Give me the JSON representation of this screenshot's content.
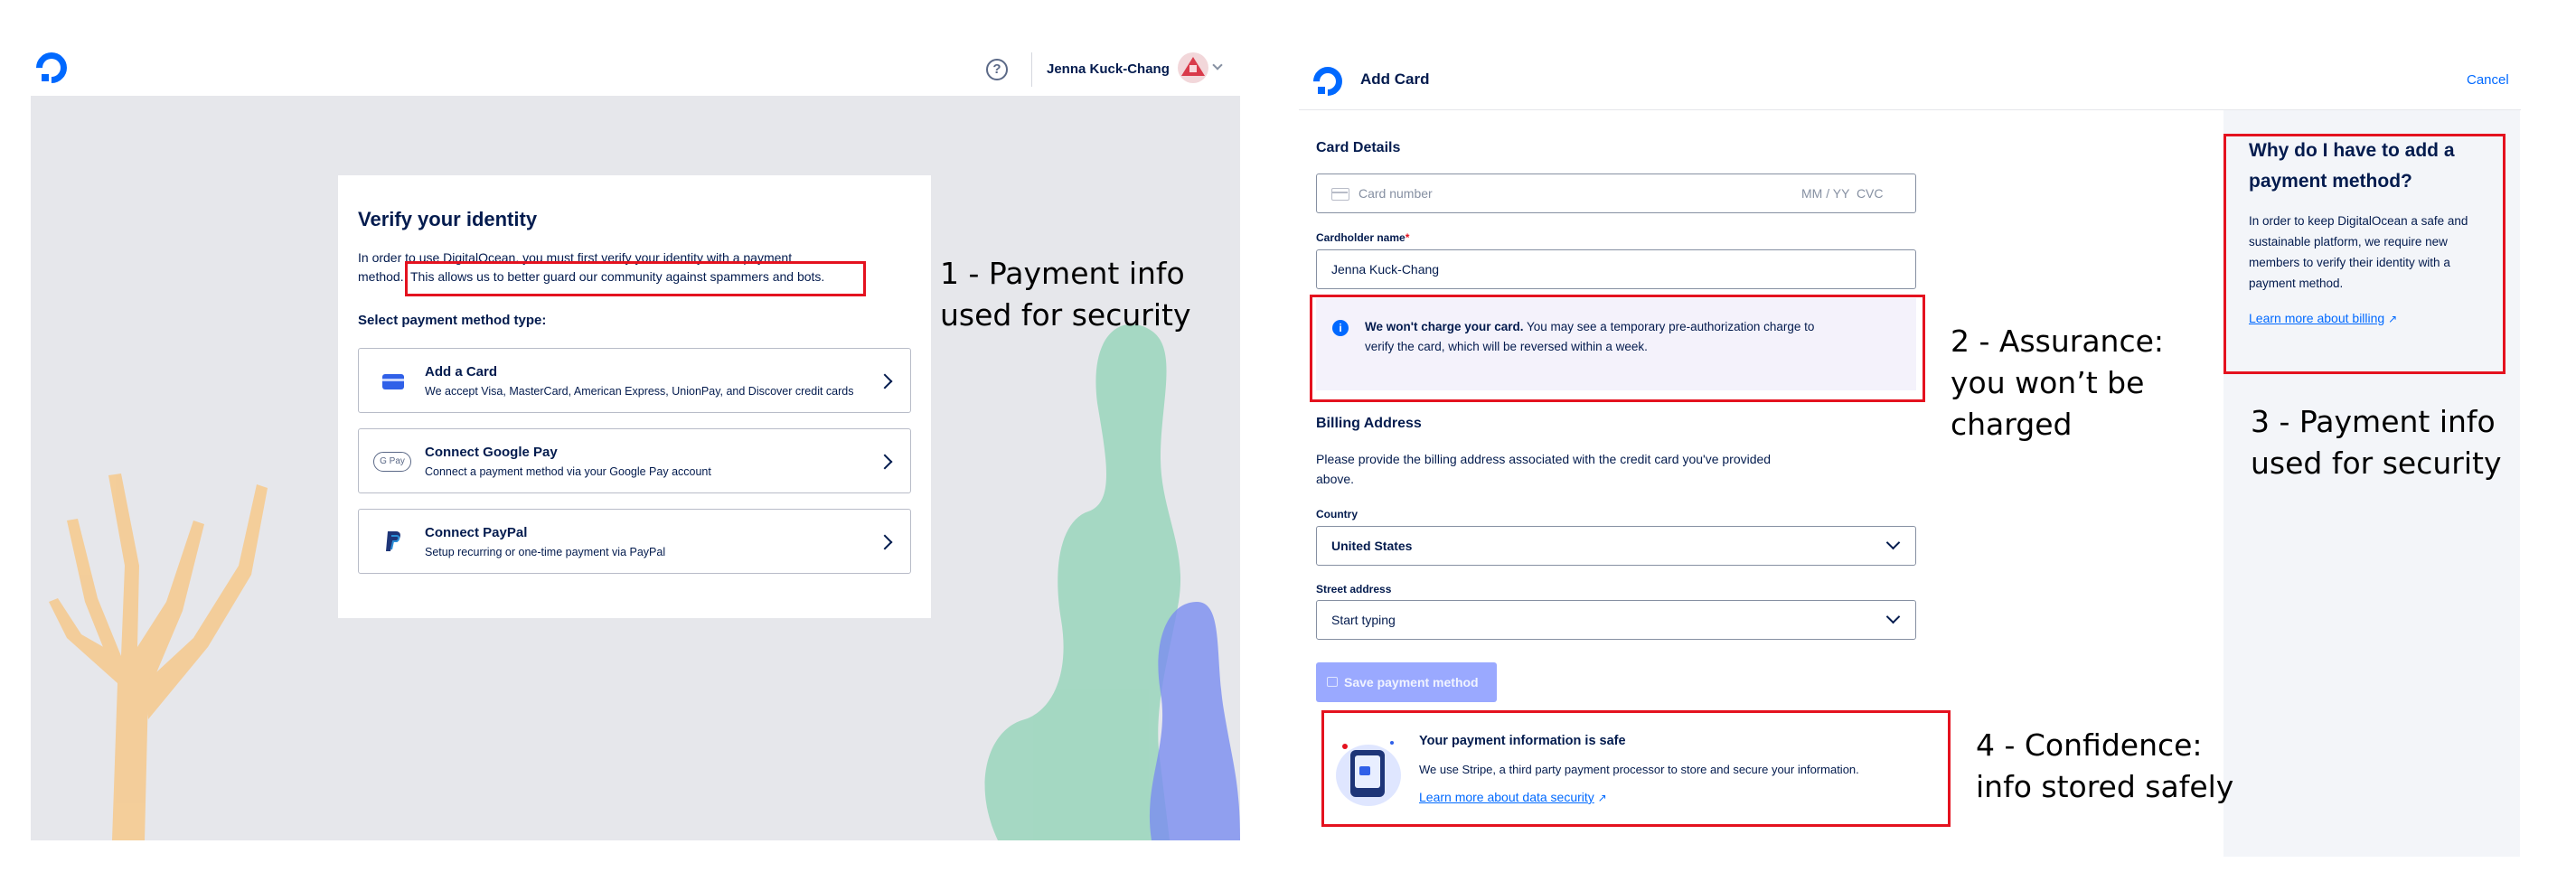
{
  "left_screen": {
    "header": {
      "help_icon": "question-circle-icon",
      "user_name": "Jenna Kuck-Chang",
      "avatar_icon": "user-avatar-icon"
    },
    "verify_card": {
      "title": "Verify your identity",
      "intro_line1": "In order to use DigitalOcean, you must first verify your identity with a payment",
      "intro_line2_prefix": "method.",
      "intro_line2_highlight": "This allows us to better guard our community against spammers and bots.",
      "select_label": "Select payment method type:",
      "options": [
        {
          "title": "Add a Card",
          "description": "We accept Visa, MasterCard, American Express, UnionPay, and Discover credit cards",
          "icon": "credit-card-icon"
        },
        {
          "title": "Connect Google Pay",
          "description": "Connect a payment method via your Google Pay account",
          "icon": "google-pay-icon",
          "icon_text": "G Pay"
        },
        {
          "title": "Connect PayPal",
          "description": "Setup recurring or one-time payment via PayPal",
          "icon": "paypal-icon"
        }
      ]
    }
  },
  "right_screen": {
    "header": {
      "title": "Add Card",
      "cancel_label": "Cancel"
    },
    "card_details": {
      "section_title": "Card Details",
      "card_number_placeholder": "Card number",
      "expiry_cvc_placeholder": "MM / YY  CVC",
      "cardholder_label": "Cardholder name",
      "required_mark": "*",
      "cardholder_value": "Jenna Kuck-Chang"
    },
    "charge_notice": {
      "bold": "We won't charge your card.",
      "line1_rest": " You may see a temporary pre-authorization charge to",
      "line2": "verify the card, which will be reversed within a week."
    },
    "billing": {
      "section_title": "Billing Address",
      "desc_line1": "Please provide the billing address associated with the credit card you've provided",
      "desc_line2": "above.",
      "country_label": "Country",
      "country_value": "United States",
      "street_label": "Street address",
      "street_placeholder": "Start typing"
    },
    "save_button": "Save payment method",
    "security_panel": {
      "title": "Your payment information is safe",
      "text": "We use Stripe, a third party payment processor to store and secure your information.",
      "link": "Learn more about data security"
    },
    "side_panel": {
      "title_line1": "Why do I have to add a",
      "title_line2": "payment method?",
      "text_lines": [
        "In order to keep DigitalOcean a safe and",
        "sustainable platform, we require new",
        "members to verify their identity with a",
        "payment method."
      ],
      "link": "Learn more about billing"
    }
  },
  "annotations": {
    "a1_line1": "1 - Payment info",
    "a1_line2": "used for security",
    "a2_line1": "2 - Assurance:",
    "a2_line2": "you won’t be",
    "a2_line3": "charged",
    "a3_line1": "3 - Payment info",
    "a3_line2": "used for security",
    "a4_line1": "4 - Confidence:",
    "a4_line2": "info stored safely"
  },
  "colors": {
    "brand_blue": "#0069ff",
    "annotation_red": "#e4121f",
    "canvas_gray": "#e6e7eb",
    "disabled_button": "#9aa9ff"
  }
}
